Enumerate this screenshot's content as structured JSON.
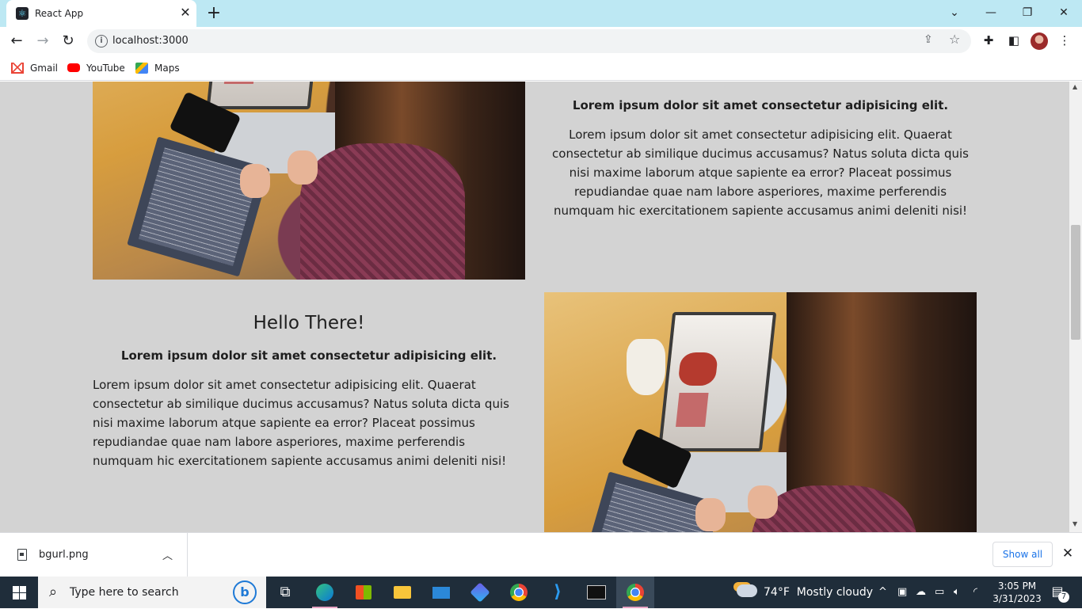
{
  "browser": {
    "tab_title": "React App",
    "url": "localhost:3000",
    "bookmarks": [
      "Gmail",
      "YouTube",
      "Maps"
    ]
  },
  "page": {
    "section1": {
      "subheading": "Lorem ipsum dolor sit amet consectetur adipisicing elit.",
      "body": "Lorem ipsum dolor sit amet consectetur adipisicing elit. Quaerat consectetur ab similique ducimus accusamus? Natus soluta dicta quis nisi maxime laborum atque sapiente ea error? Placeat possimus repudiandae quae nam labore asperiores, maxime perferendis numquam hic exercitationem sapiente accusamus animi deleniti nisi!"
    },
    "section2": {
      "heading": "Hello There!",
      "subheading": "Lorem ipsum dolor sit amet consectetur adipisicing elit.",
      "body": "Lorem ipsum dolor sit amet consectetur adipisicing elit. Quaerat consectetur ab similique ducimus accusamus? Natus soluta dicta quis nisi maxime laborum atque sapiente ea error? Placeat possimus repudiandae quae nam labore asperiores, maxime perferendis numquam hic exercitationem sapiente accusamus animi deleniti nisi!"
    }
  },
  "download_bar": {
    "file_name": "bgurl.png",
    "show_all_label": "Show all"
  },
  "taskbar": {
    "search_placeholder": "Type here to search",
    "weather_temp": "74°F",
    "weather_text": "Mostly cloudy",
    "time": "3:05 PM",
    "date": "3/31/2023",
    "notification_count": "7"
  },
  "colors": {
    "tabstrip": "#bde8f3",
    "page_background": "#d3d3d3",
    "taskbar": "#1f2d3a",
    "link_blue": "#1a73e8"
  }
}
